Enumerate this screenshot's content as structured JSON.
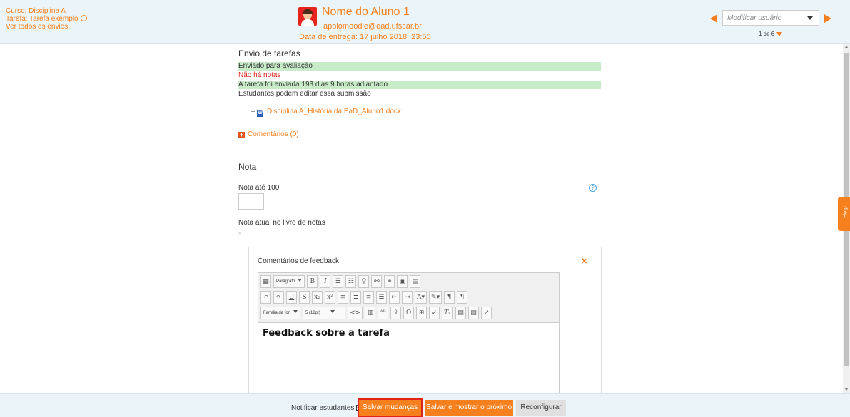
{
  "header": {
    "course_link": "Curso: Disciplina A",
    "assignment_link": "Tarefa: Tarefa exemplo",
    "view_all_link": "Ver todos os envios",
    "student_name": "Nome do Aluno 1",
    "student_email": "apoiomoodle@ead.ufscar.br",
    "due_date": "Data de entrega: 17 julho 2018, 23:55",
    "change_user_placeholder": "Modificar usuário",
    "pager": "1 de 6"
  },
  "submission": {
    "title": "Envio de tarefas",
    "status_submitted": "Enviado para avaliação",
    "status_no_grade": "Não há notas",
    "status_early": "A tarefa foi enviada 193 dias 9 horas adiantado",
    "status_editable": "Estudantes podem editar essa submissão",
    "file_name": "Disciplina A_História da EaD_Aluno1.docx",
    "comments_label": "Comentários (0)"
  },
  "grade": {
    "title": "Nota",
    "grade_label": "Nota até 100",
    "grade_value": "",
    "current_grade_label": "Nota atual no livro de notas",
    "current_grade_value": "-"
  },
  "feedback": {
    "title": "Comentários de feedback",
    "paragraph_select": "Parágrafo",
    "font_family_select": "Família da fon",
    "font_size_select": "5 (18pt)",
    "content": "Feedback sobre a tarefa"
  },
  "footer": {
    "notify_label": "Notificar estudantes",
    "notify_checked": true,
    "save_button": "Salvar mudanças",
    "save_next_button": "Salvar e mostrar o próximo",
    "reset_button": "Reconfigurar"
  },
  "help_tab": "Help",
  "colors": {
    "accent": "#f7801e",
    "header_bg": "#eaf4f9",
    "success_bg": "#c8ecc8",
    "error_text": "#e2231a"
  }
}
